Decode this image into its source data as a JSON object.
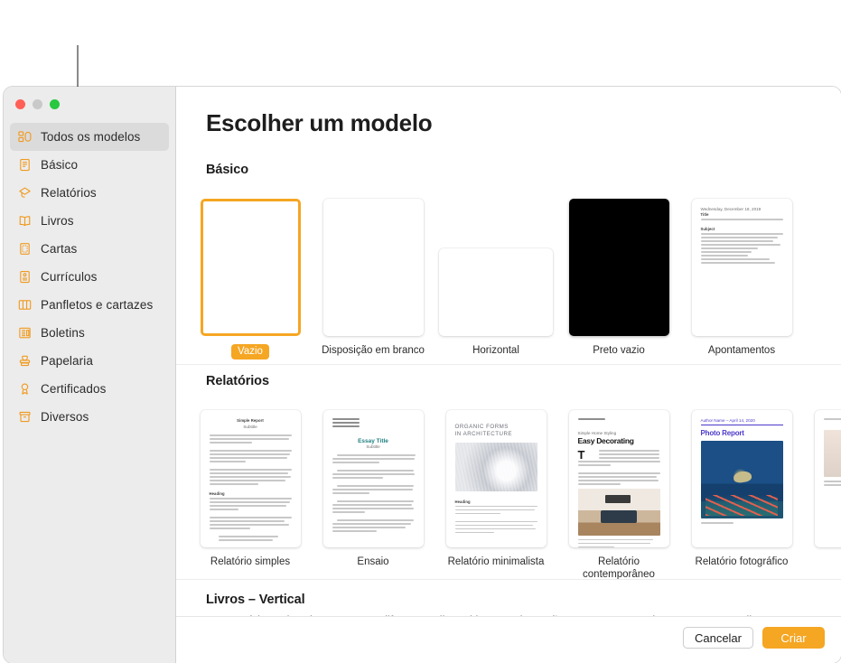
{
  "window": {
    "traffic_lights": [
      "close",
      "minimize",
      "zoom"
    ]
  },
  "sidebar": {
    "items": [
      {
        "label": "Todos os modelos",
        "icon": "all-templates-icon",
        "selected": true
      },
      {
        "label": "Básico",
        "icon": "basic-document-icon",
        "selected": false
      },
      {
        "label": "Relatórios",
        "icon": "graduation-cap-icon",
        "selected": false
      },
      {
        "label": "Livros",
        "icon": "open-book-icon",
        "selected": false
      },
      {
        "label": "Cartas",
        "icon": "framed-card-icon",
        "selected": false
      },
      {
        "label": "Currículos",
        "icon": "resume-icon",
        "selected": false
      },
      {
        "label": "Panfletos e cartazes",
        "icon": "brochure-icon",
        "selected": false
      },
      {
        "label": "Boletins",
        "icon": "newsletter-icon",
        "selected": false
      },
      {
        "label": "Papelaria",
        "icon": "stamp-icon",
        "selected": false
      },
      {
        "label": "Certificados",
        "icon": "award-ribbon-icon",
        "selected": false
      },
      {
        "label": "Diversos",
        "icon": "archive-box-icon",
        "selected": false
      }
    ]
  },
  "main": {
    "title": "Escolher um modelo",
    "sections": [
      {
        "heading": "Básico",
        "templates": [
          {
            "label": "Vazio",
            "selected": true,
            "orientation": "portrait",
            "style": "blank"
          },
          {
            "label": "Disposição em branco",
            "selected": false,
            "orientation": "portrait",
            "style": "blank"
          },
          {
            "label": "Horizontal",
            "selected": false,
            "orientation": "landscape",
            "style": "blank"
          },
          {
            "label": "Preto vazio",
            "selected": false,
            "orientation": "portrait",
            "style": "black"
          },
          {
            "label": "Apontamentos",
            "selected": false,
            "orientation": "portrait",
            "style": "notes"
          }
        ]
      },
      {
        "heading": "Relatórios",
        "templates": [
          {
            "label": "Relatório simples",
            "selected": false,
            "orientation": "portrait",
            "style": "simple-report"
          },
          {
            "label": "Ensaio",
            "selected": false,
            "orientation": "portrait",
            "style": "essay"
          },
          {
            "label": "Relatório minimalista",
            "selected": false,
            "orientation": "portrait",
            "style": "minimal-report"
          },
          {
            "label": "Relatório contemporâneo",
            "selected": false,
            "orientation": "portrait",
            "style": "contemporary-report"
          },
          {
            "label": "Relatório fotográfico",
            "selected": false,
            "orientation": "portrait",
            "style": "photo-report"
          },
          {
            "label": "",
            "selected": false,
            "orientation": "portrait",
            "style": "partial"
          }
        ]
      }
    ],
    "last_section": {
      "heading": "Livros – Vertical",
      "description": "O conteúdo pode adaptar-se aos diferentes dispositivos e orientações ao ser exportado para EPUB. Melhor para"
    }
  },
  "thumbnail_text": {
    "notes": {
      "date": "Wednesday, December 18, 2019",
      "title": "Title",
      "subject": "Subject"
    },
    "simple_report": {
      "title": "Simple Report",
      "subtitle": "Subtitle",
      "heading": "Heading"
    },
    "essay": {
      "title": "Essay Title",
      "subtitle": "Subtitle"
    },
    "minimal_report": {
      "title_line1": "ORGANIC FORMS",
      "title_line2": "IN ARCHITECTURE",
      "heading": "Heading"
    },
    "contemporary_report": {
      "kicker": "Simple Home Styling",
      "title": "Easy Decorating"
    },
    "photo_report": {
      "byline": "Author Name – April 14, 2020",
      "title": "Photo Report"
    }
  },
  "footer": {
    "cancel_label": "Cancelar",
    "create_label": "Criar"
  },
  "colors": {
    "accent_orange": "#f5a623",
    "sidebar_bg": "#ececec",
    "selected_row": "#dbdbdb",
    "teal": "#1f7f80",
    "purple": "#4b39c9"
  }
}
